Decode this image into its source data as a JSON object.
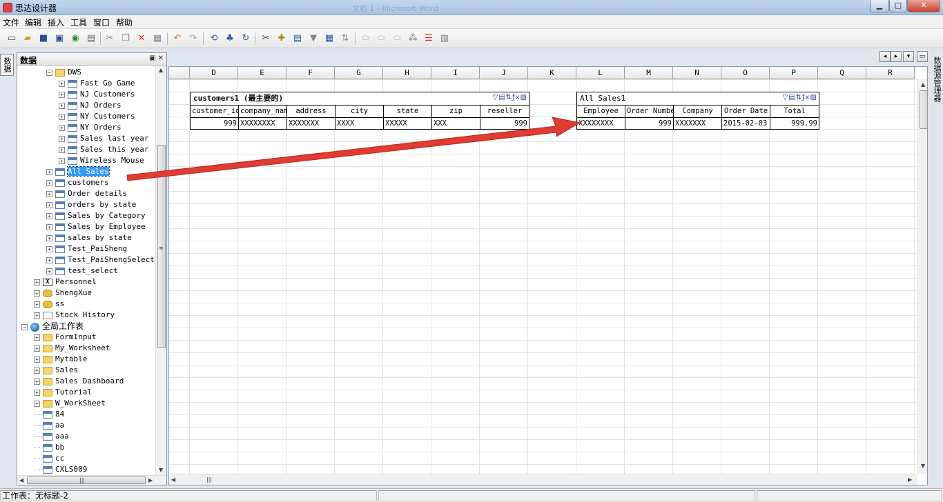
{
  "window": {
    "title": "思达设计器",
    "background_title": "文档 1 - Microsoft Word",
    "buttons": {
      "minimize": "▁",
      "maximize": "□",
      "close": "✕"
    }
  },
  "menu": [
    "文件",
    "编辑",
    "插入",
    "工具",
    "窗口",
    "帮助"
  ],
  "toolbar_icons": [
    "new-icon",
    "open-icon",
    "save-icon",
    "save-all-icon",
    "refresh-icon",
    "print-icon",
    "cut-icon",
    "copy-icon",
    "delete-icon",
    "paste-icon",
    "undo-icon",
    "redo-icon",
    "sync-icon",
    "hierarchy-icon",
    "reload-icon",
    "tools-icon",
    "add-table-icon",
    "add-column-icon",
    "filter-icon",
    "insert-icon",
    "sort-icon",
    "oval-icon",
    "oval2-icon",
    "oval3-icon",
    "grid-icon",
    "merge-icon",
    "split-icon"
  ],
  "left_tab": "数据",
  "right_tab": "数据源管理器",
  "panel": {
    "title": "数据",
    "pin": "▣",
    "close": "✕"
  },
  "tree": [
    {
      "label": "DWS",
      "icon": "folder",
      "indent": 2,
      "expander": "−"
    },
    {
      "label": "Fast Go Game",
      "icon": "table",
      "indent": 3,
      "expander": "+"
    },
    {
      "label": "NJ Customers",
      "icon": "table",
      "indent": 3,
      "expander": "+"
    },
    {
      "label": "NJ Orders",
      "icon": "table",
      "indent": 3,
      "expander": "+"
    },
    {
      "label": "NY Customers",
      "icon": "table",
      "indent": 3,
      "expander": "+"
    },
    {
      "label": "NY Orders",
      "icon": "table",
      "indent": 3,
      "expander": "+"
    },
    {
      "label": "Sales last year",
      "icon": "table",
      "indent": 3,
      "expander": "+"
    },
    {
      "label": "Sales this year",
      "icon": "table",
      "indent": 3,
      "expander": "+"
    },
    {
      "label": "Wireless Mouse",
      "icon": "table",
      "indent": 3,
      "expander": "+"
    },
    {
      "label": "All Sales",
      "icon": "table",
      "indent": 2,
      "expander": "+",
      "selected": true
    },
    {
      "label": "customers",
      "icon": "table",
      "indent": 2,
      "expander": "+"
    },
    {
      "label": "Order details",
      "icon": "table",
      "indent": 2,
      "expander": "+"
    },
    {
      "label": "orders by state",
      "icon": "table",
      "indent": 2,
      "expander": "+"
    },
    {
      "label": "Sales by Category",
      "icon": "table",
      "indent": 2,
      "expander": "+"
    },
    {
      "label": "Sales by Employee",
      "icon": "table",
      "indent": 2,
      "expander": "+"
    },
    {
      "label": "sales by state",
      "icon": "table",
      "indent": 2,
      "expander": "+"
    },
    {
      "label": "Test_PaiSheng",
      "icon": "table",
      "indent": 2,
      "expander": "+"
    },
    {
      "label": "Test_PaiShengSelect",
      "icon": "table",
      "indent": 2,
      "expander": "+"
    },
    {
      "label": "test_select",
      "icon": "table",
      "indent": 2,
      "expander": "+"
    },
    {
      "label": "Personnel",
      "icon": "x",
      "indent": 1,
      "expander": "+"
    },
    {
      "label": "ShengXue",
      "icon": "db",
      "indent": 1,
      "expander": "+"
    },
    {
      "label": "ss",
      "icon": "db",
      "indent": 1,
      "expander": "+"
    },
    {
      "label": "Stock History",
      "icon": "doc",
      "indent": 1,
      "expander": "+"
    },
    {
      "label": "全局工作表",
      "icon": "globe",
      "indent": 0,
      "expander": "−"
    },
    {
      "label": "FormInput",
      "icon": "folder",
      "indent": 1,
      "expander": "+"
    },
    {
      "label": "My_Worksheet",
      "icon": "folder",
      "indent": 1,
      "expander": "+"
    },
    {
      "label": "Mytable",
      "icon": "folder",
      "indent": 1,
      "expander": "+"
    },
    {
      "label": "Sales",
      "icon": "folder",
      "indent": 1,
      "expander": "+"
    },
    {
      "label": "Sales Dashboard",
      "icon": "folder",
      "indent": 1,
      "expander": "+"
    },
    {
      "label": "Tutorial",
      "icon": "folder",
      "indent": 1,
      "expander": "+"
    },
    {
      "label": "W_WorkSheet",
      "icon": "folder",
      "indent": 1,
      "expander": "+"
    },
    {
      "label": "84",
      "icon": "sheet",
      "indent": 1,
      "expander": ""
    },
    {
      "label": "aa",
      "icon": "sheet",
      "indent": 1,
      "expander": ""
    },
    {
      "label": "aaa",
      "icon": "sheet",
      "indent": 1,
      "expander": ""
    },
    {
      "label": "bb",
      "icon": "sheet",
      "indent": 1,
      "expander": ""
    },
    {
      "label": "cc",
      "icon": "sheet",
      "indent": 1,
      "expander": ""
    },
    {
      "label": "CXLS009",
      "icon": "sheet",
      "indent": 1,
      "expander": ""
    }
  ],
  "columns": [
    "D",
    "E",
    "F",
    "G",
    "H",
    "I",
    "J",
    "K",
    "L",
    "M",
    "N",
    "O",
    "P",
    "Q",
    "R"
  ],
  "table1": {
    "name": "customers1",
    "suffix": "(最主要的)",
    "headers": [
      "customer_id",
      "company_name",
      "address",
      "city",
      "state",
      "zip",
      "reseller"
    ],
    "row": [
      "999",
      "XXXXXXXX",
      "XXXXXXX",
      "XXXX",
      "XXXXX",
      "XXX",
      "999"
    ]
  },
  "table2": {
    "name": "All Sales1",
    "suffix": "",
    "headers": [
      "Employee",
      "Order Number",
      "Company",
      "Order Date",
      "Total"
    ],
    "row": [
      "XXXXXXXX",
      "999",
      "XXXXXXX",
      "2015-02-03",
      "999.99"
    ]
  },
  "table_icons": "▽▤⇅ƒx▨",
  "scroll": {
    "up": "▲",
    "down": "▼",
    "left": "◀",
    "right": "▶",
    "grip": "≡",
    "hgrip": "|||"
  },
  "sheet_nav": {
    "prev": "◂",
    "next": "▸",
    "down": "▾",
    "restore": "▭"
  },
  "status": {
    "sheet_label": "工作表：无标题-2"
  },
  "colors": {
    "arrow": "#e03c32",
    "selection": "#3399ff"
  }
}
